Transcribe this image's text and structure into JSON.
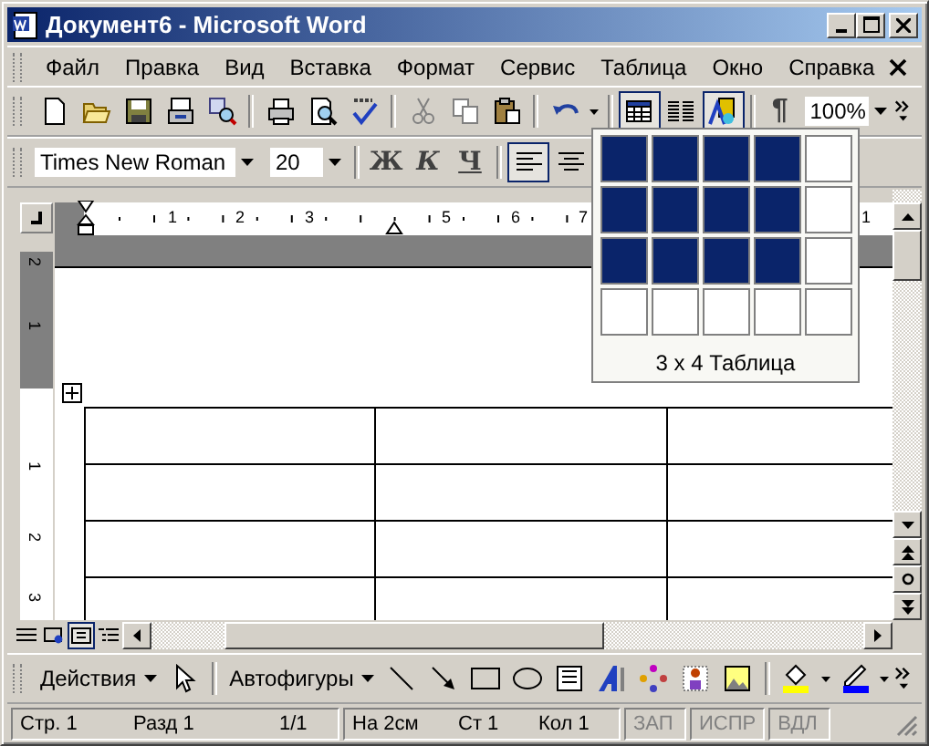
{
  "window": {
    "title": "Документ6 - Microsoft Word"
  },
  "menu": [
    "Файл",
    "Правка",
    "Вид",
    "Вставка",
    "Формат",
    "Сервис",
    "Таблица",
    "Окно",
    "Справка"
  ],
  "standard_toolbar": {
    "cut_disabled": true,
    "copy_disabled": true,
    "table_pressed": true,
    "drawing_pressed": true,
    "pilcrow": "¶",
    "zoom": "100%"
  },
  "table_picker": {
    "grid": [
      [
        true,
        true,
        true,
        true,
        false
      ],
      [
        true,
        true,
        true,
        true,
        false
      ],
      [
        true,
        true,
        true,
        true,
        false
      ],
      [
        false,
        false,
        false,
        false,
        false
      ]
    ],
    "caption": "3 x 4 Таблица"
  },
  "formatting_toolbar": {
    "font": "Times New Roman",
    "size": "20",
    "bold": "Ж",
    "italic": "К",
    "underline": "Ч",
    "alignment": [
      {
        "selected": true
      },
      {
        "selected": false
      }
    ]
  },
  "ruler": {
    "marks": [
      "1",
      "2",
      "3",
      "5",
      "6",
      "7",
      "1"
    ]
  },
  "vertical_ruler": {
    "marks": [
      "2",
      "1",
      "1",
      "2",
      "3"
    ]
  },
  "views": [
    {
      "selected": false
    },
    {
      "selected": false
    },
    {
      "selected": true
    },
    {
      "selected": false
    }
  ],
  "drawing_toolbar": {
    "actions": "Действия",
    "autoshapes": "Автофигуры"
  },
  "status_bar": {
    "panels": [
      {
        "fields": [
          {
            "text": "Стр. 1",
            "disabled": false
          },
          {
            "text": "Разд 1",
            "disabled": false
          },
          {
            "text": "1/1",
            "disabled": false
          }
        ]
      },
      {
        "fields": [
          {
            "text": "На 2см",
            "disabled": false
          },
          {
            "text": "Ст 1",
            "disabled": false
          },
          {
            "text": "Кол 1",
            "disabled": false
          }
        ]
      },
      {
        "fields": [
          {
            "text": "ЗАП",
            "disabled": true
          }
        ]
      },
      {
        "fields": [
          {
            "text": "ИСПР",
            "disabled": true
          }
        ]
      },
      {
        "fields": [
          {
            "text": "ВДЛ",
            "disabled": true
          }
        ]
      }
    ]
  }
}
